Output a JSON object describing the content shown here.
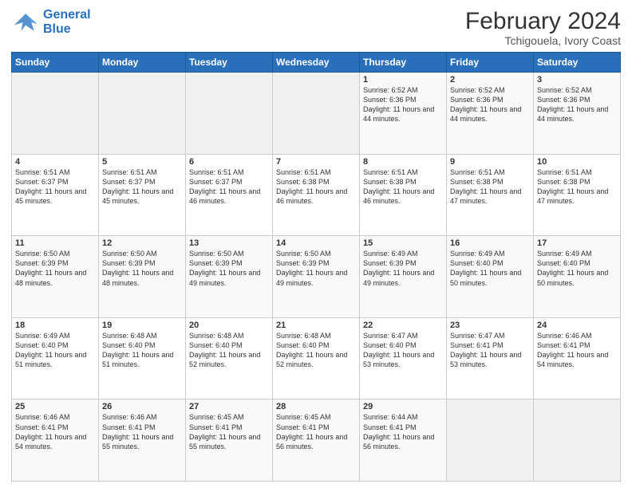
{
  "logo": {
    "line1": "General",
    "line2": "Blue"
  },
  "title": "February 2024",
  "location": "Tchigouela, Ivory Coast",
  "days_header": [
    "Sunday",
    "Monday",
    "Tuesday",
    "Wednesday",
    "Thursday",
    "Friday",
    "Saturday"
  ],
  "weeks": [
    [
      {
        "num": "",
        "info": ""
      },
      {
        "num": "",
        "info": ""
      },
      {
        "num": "",
        "info": ""
      },
      {
        "num": "",
        "info": ""
      },
      {
        "num": "1",
        "info": "Sunrise: 6:52 AM\nSunset: 6:36 PM\nDaylight: 11 hours and 44 minutes."
      },
      {
        "num": "2",
        "info": "Sunrise: 6:52 AM\nSunset: 6:36 PM\nDaylight: 11 hours and 44 minutes."
      },
      {
        "num": "3",
        "info": "Sunrise: 6:52 AM\nSunset: 6:36 PM\nDaylight: 11 hours and 44 minutes."
      }
    ],
    [
      {
        "num": "4",
        "info": "Sunrise: 6:51 AM\nSunset: 6:37 PM\nDaylight: 11 hours and 45 minutes."
      },
      {
        "num": "5",
        "info": "Sunrise: 6:51 AM\nSunset: 6:37 PM\nDaylight: 11 hours and 45 minutes."
      },
      {
        "num": "6",
        "info": "Sunrise: 6:51 AM\nSunset: 6:37 PM\nDaylight: 11 hours and 46 minutes."
      },
      {
        "num": "7",
        "info": "Sunrise: 6:51 AM\nSunset: 6:38 PM\nDaylight: 11 hours and 46 minutes."
      },
      {
        "num": "8",
        "info": "Sunrise: 6:51 AM\nSunset: 6:38 PM\nDaylight: 11 hours and 46 minutes."
      },
      {
        "num": "9",
        "info": "Sunrise: 6:51 AM\nSunset: 6:38 PM\nDaylight: 11 hours and 47 minutes."
      },
      {
        "num": "10",
        "info": "Sunrise: 6:51 AM\nSunset: 6:38 PM\nDaylight: 11 hours and 47 minutes."
      }
    ],
    [
      {
        "num": "11",
        "info": "Sunrise: 6:50 AM\nSunset: 6:39 PM\nDaylight: 11 hours and 48 minutes."
      },
      {
        "num": "12",
        "info": "Sunrise: 6:50 AM\nSunset: 6:39 PM\nDaylight: 11 hours and 48 minutes."
      },
      {
        "num": "13",
        "info": "Sunrise: 6:50 AM\nSunset: 6:39 PM\nDaylight: 11 hours and 49 minutes."
      },
      {
        "num": "14",
        "info": "Sunrise: 6:50 AM\nSunset: 6:39 PM\nDaylight: 11 hours and 49 minutes."
      },
      {
        "num": "15",
        "info": "Sunrise: 6:49 AM\nSunset: 6:39 PM\nDaylight: 11 hours and 49 minutes."
      },
      {
        "num": "16",
        "info": "Sunrise: 6:49 AM\nSunset: 6:40 PM\nDaylight: 11 hours and 50 minutes."
      },
      {
        "num": "17",
        "info": "Sunrise: 6:49 AM\nSunset: 6:40 PM\nDaylight: 11 hours and 50 minutes."
      }
    ],
    [
      {
        "num": "18",
        "info": "Sunrise: 6:49 AM\nSunset: 6:40 PM\nDaylight: 11 hours and 51 minutes."
      },
      {
        "num": "19",
        "info": "Sunrise: 6:48 AM\nSunset: 6:40 PM\nDaylight: 11 hours and 51 minutes."
      },
      {
        "num": "20",
        "info": "Sunrise: 6:48 AM\nSunset: 6:40 PM\nDaylight: 11 hours and 52 minutes."
      },
      {
        "num": "21",
        "info": "Sunrise: 6:48 AM\nSunset: 6:40 PM\nDaylight: 11 hours and 52 minutes."
      },
      {
        "num": "22",
        "info": "Sunrise: 6:47 AM\nSunset: 6:40 PM\nDaylight: 11 hours and 53 minutes."
      },
      {
        "num": "23",
        "info": "Sunrise: 6:47 AM\nSunset: 6:41 PM\nDaylight: 11 hours and 53 minutes."
      },
      {
        "num": "24",
        "info": "Sunrise: 6:46 AM\nSunset: 6:41 PM\nDaylight: 11 hours and 54 minutes."
      }
    ],
    [
      {
        "num": "25",
        "info": "Sunrise: 6:46 AM\nSunset: 6:41 PM\nDaylight: 11 hours and 54 minutes."
      },
      {
        "num": "26",
        "info": "Sunrise: 6:46 AM\nSunset: 6:41 PM\nDaylight: 11 hours and 55 minutes."
      },
      {
        "num": "27",
        "info": "Sunrise: 6:45 AM\nSunset: 6:41 PM\nDaylight: 11 hours and 55 minutes."
      },
      {
        "num": "28",
        "info": "Sunrise: 6:45 AM\nSunset: 6:41 PM\nDaylight: 11 hours and 56 minutes."
      },
      {
        "num": "29",
        "info": "Sunrise: 6:44 AM\nSunset: 6:41 PM\nDaylight: 11 hours and 56 minutes."
      },
      {
        "num": "",
        "info": ""
      },
      {
        "num": "",
        "info": ""
      }
    ]
  ]
}
